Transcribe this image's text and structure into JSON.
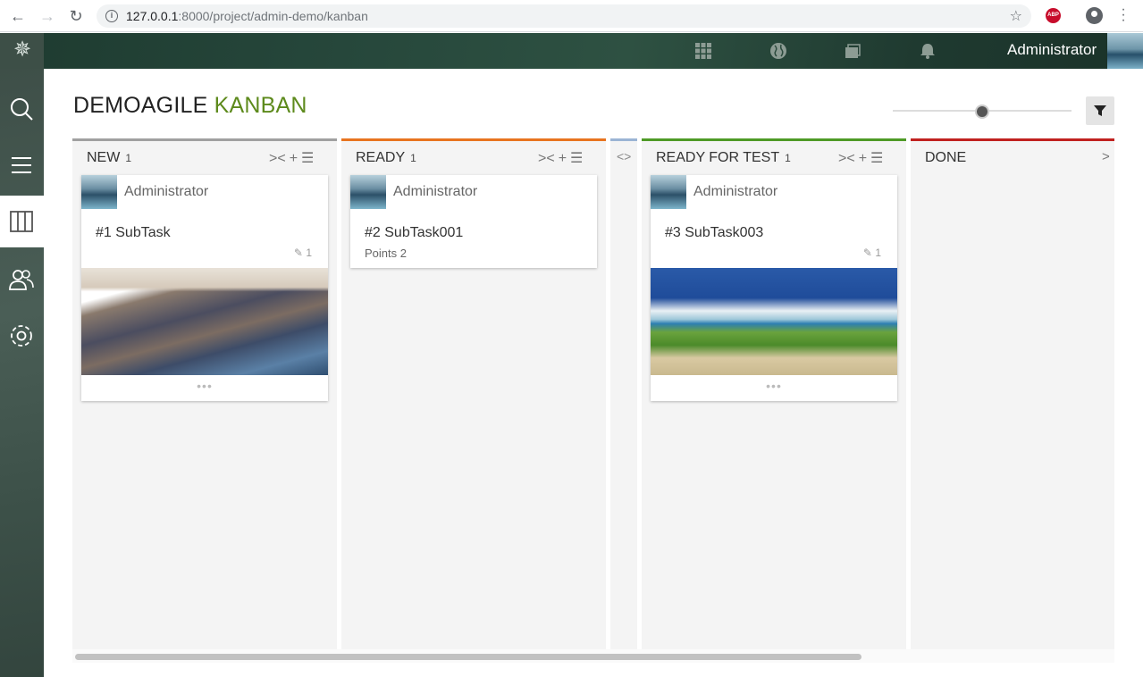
{
  "browser": {
    "url_host": "127.0.0.1",
    "url_rest": ":8000/project/admin-demo/kanban"
  },
  "header": {
    "user_name": "Administrator"
  },
  "page": {
    "title_main": "DEMOAGILE",
    "title_accent": "KANBAN",
    "accent_color": "#5d8a1c",
    "zoom_level": 0.5
  },
  "columns": [
    {
      "name": "NEW",
      "count": "1",
      "color": "#a0a0a0"
    },
    {
      "name": "READY",
      "count": "1",
      "color": "#e8741f"
    },
    {
      "name": "READY FOR TEST",
      "count": "1",
      "color": "#4e9a26"
    },
    {
      "name": "DONE",
      "count": "",
      "color": "#c0211f"
    }
  ],
  "cards": [
    {
      "user": "Administrator",
      "title": "#1 SubTask",
      "meta": "",
      "attachments": "1"
    },
    {
      "user": "Administrator",
      "title": "#2 SubTask001",
      "meta": "Points 2",
      "attachments": ""
    },
    {
      "user": "Administrator",
      "title": "#3 SubTask003",
      "meta": "",
      "attachments": "1"
    }
  ]
}
